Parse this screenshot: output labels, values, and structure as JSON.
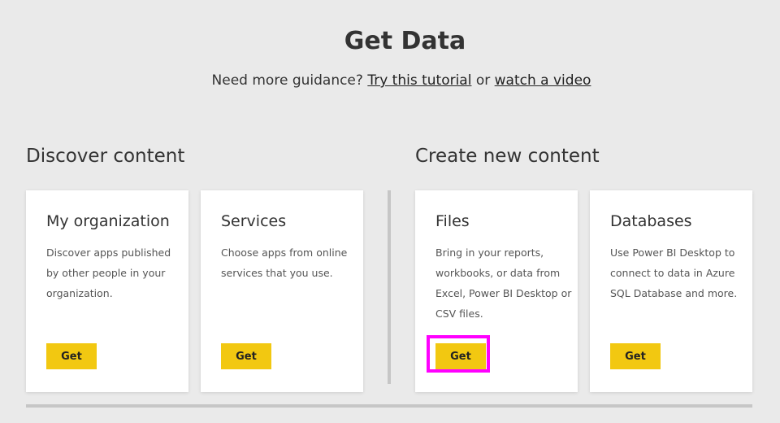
{
  "header": {
    "title": "Get Data",
    "guidance_text": "Need more guidance?",
    "tutorial_link": "Try this tutorial",
    "or_text": "or",
    "video_link": "watch a video"
  },
  "sections": {
    "discover": {
      "heading": "Discover content",
      "cards": [
        {
          "title": "My organization",
          "description": "Discover apps published by other people in your organization.",
          "button": "Get"
        },
        {
          "title": "Services",
          "description": "Choose apps from online services that you use.",
          "button": "Get"
        }
      ]
    },
    "create": {
      "heading": "Create new content",
      "cards": [
        {
          "title": "Files",
          "description": "Bring in your reports, workbooks, or data from Excel, Power BI Desktop or CSV files.",
          "button": "Get"
        },
        {
          "title": "Databases",
          "description": "Use Power BI Desktop to connect to data in Azure SQL Database and more.",
          "button": "Get"
        }
      ]
    }
  },
  "colors": {
    "background": "#eaeaea",
    "card": "#ffffff",
    "button": "#f2c811",
    "highlight": "#ff00ff",
    "divider": "#c6c6c6"
  }
}
